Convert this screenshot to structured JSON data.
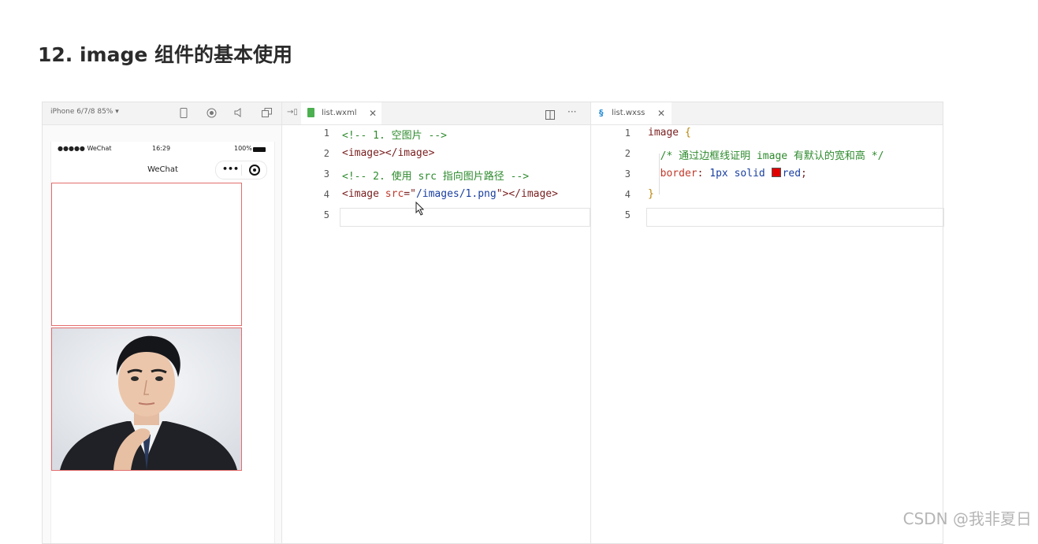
{
  "heading": "12. image 组件的基本使用",
  "simulator": {
    "device_label": "iPhone 6/7/8 85% ▾",
    "status": {
      "carrier": "●●●●● WeChat",
      "time": "16:29",
      "battery": "100%"
    },
    "nav_title": "WeChat",
    "capsule_dots": "•••"
  },
  "editor_left": {
    "tab_label": "list.wxml",
    "close_glyph": "✕",
    "lines": [
      {
        "no": "1",
        "parts": [
          {
            "t": "<!-- 1. 空图片 -->",
            "c": "comment"
          }
        ]
      },
      {
        "no": "2",
        "parts": [
          {
            "t": "<image></image>",
            "c": "tag"
          }
        ]
      },
      {
        "no": "3",
        "parts": [
          {
            "t": "<!-- 2. 使用 src 指向图片路径 -->",
            "c": "comment"
          }
        ]
      },
      {
        "no": "4",
        "parts": [
          {
            "t": "<image ",
            "c": "tag"
          },
          {
            "t": "src",
            "c": "attr"
          },
          {
            "t": "=\"",
            "c": "tag"
          },
          {
            "t": "/images/1.png",
            "c": "str"
          },
          {
            "t": "\"></image>",
            "c": "tag"
          }
        ]
      },
      {
        "no": "5",
        "parts": []
      }
    ]
  },
  "editor_right": {
    "tab_label": "list.wxss",
    "close_glyph": "✕",
    "lines": [
      {
        "no": "1",
        "parts": [
          {
            "t": "image ",
            "c": "sel"
          },
          {
            "t": "{",
            "c": "brace"
          }
        ]
      },
      {
        "no": "2",
        "parts": [
          {
            "t": "  /* 通过边框线证明 image 有默认的宽和高 */",
            "c": "comment"
          }
        ]
      },
      {
        "no": "3",
        "parts": [
          {
            "t": "  border",
            "c": "prop"
          },
          {
            "t": ": ",
            "c": "tag"
          },
          {
            "t": "1px solid ",
            "c": "val"
          },
          {
            "t": "SWATCH",
            "c": "swatch"
          },
          {
            "t": "red",
            "c": "val"
          },
          {
            "t": ";",
            "c": "tag"
          }
        ]
      },
      {
        "no": "4",
        "parts": [
          {
            "t": "}",
            "c": "brace"
          }
        ]
      },
      {
        "no": "5",
        "parts": []
      }
    ]
  },
  "watermark": "CSDN @我非夏日",
  "colors": {
    "border_red": "#e46d6d",
    "swatch_red": "#e00000",
    "comment_green": "#2e8b2e"
  }
}
